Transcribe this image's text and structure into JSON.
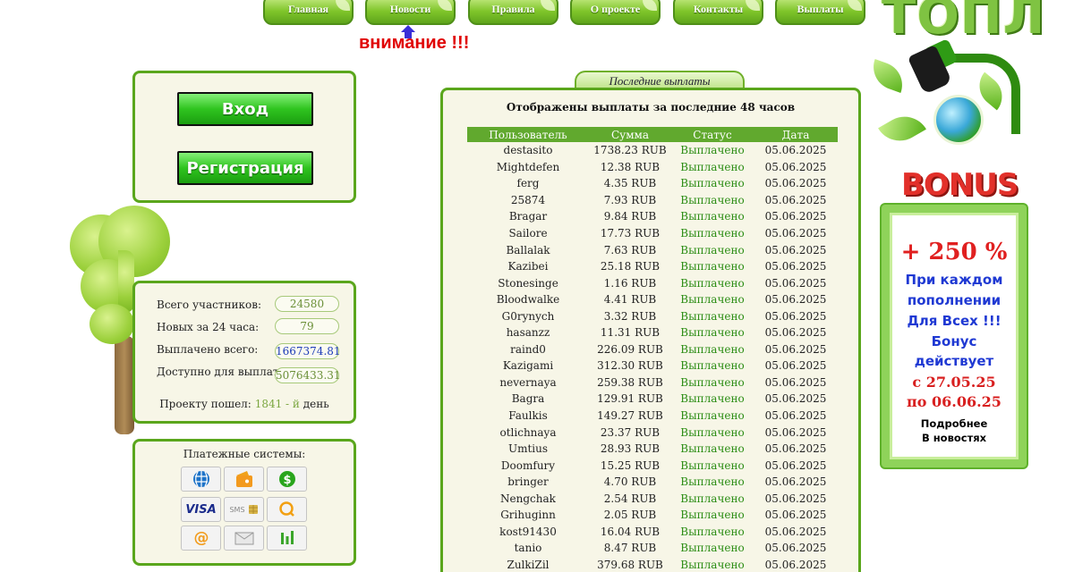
{
  "nav": {
    "items": [
      "Главная",
      "Новости",
      "Правила",
      "О проекте",
      "Контакты",
      "Выплаты"
    ]
  },
  "attention": "внимание !!!",
  "auth": {
    "login_label": "Вход",
    "register_label": "Регистрация"
  },
  "stats": {
    "total_participants_label": "Всего участников:",
    "total_participants": "24580",
    "new_24h_label": "Новых за 24 часа:",
    "new_24h": "79",
    "paid_total_label": "Выплачено всего:",
    "paid_total": "1667374.81",
    "available_label": "Доступно для выплат:",
    "available": "5076433.31",
    "age_prefix": "Проекту пошел:",
    "age_value": "1841 - й",
    "age_suffix": "день"
  },
  "payment_systems": {
    "title": "Платежные системы:",
    "items": [
      "webmoney-icon",
      "yandex-money-icon",
      "dollar-icon",
      "visa-icon",
      "sms-icon",
      "qiwi-icon",
      "at-icon",
      "envelope-icon",
      "bars-icon"
    ],
    "visa_text": "VISA",
    "sms_text": "SMS"
  },
  "payouts": {
    "tab_label": "Последние выплаты",
    "heading": "Отображены выплаты за последние 48 часов",
    "columns": [
      "Пользователь",
      "Сумма",
      "Статус",
      "Дата"
    ],
    "rows": [
      [
        "destasito",
        "1738.23 RUB",
        "Выплачено",
        "05.06.2025"
      ],
      [
        "Mightdefen",
        "12.38 RUB",
        "Выплачено",
        "05.06.2025"
      ],
      [
        "ferg",
        "4.35 RUB",
        "Выплачено",
        "05.06.2025"
      ],
      [
        "25874",
        "7.93 RUB",
        "Выплачено",
        "05.06.2025"
      ],
      [
        "Bragar",
        "9.84 RUB",
        "Выплачено",
        "05.06.2025"
      ],
      [
        "Sailore",
        "17.73 RUB",
        "Выплачено",
        "05.06.2025"
      ],
      [
        "Ballalak",
        "7.63 RUB",
        "Выплачено",
        "05.06.2025"
      ],
      [
        "Kazibei",
        "25.18 RUB",
        "Выплачено",
        "05.06.2025"
      ],
      [
        "Stonesinge",
        "1.16 RUB",
        "Выплачено",
        "05.06.2025"
      ],
      [
        "Bloodwalke",
        "4.41 RUB",
        "Выплачено",
        "05.06.2025"
      ],
      [
        "G0rynych",
        "3.32 RUB",
        "Выплачено",
        "05.06.2025"
      ],
      [
        "hasanzz",
        "11.31 RUB",
        "Выплачено",
        "05.06.2025"
      ],
      [
        "raind0",
        "226.09 RUB",
        "Выплачено",
        "05.06.2025"
      ],
      [
        "Kazigami",
        "312.30 RUB",
        "Выплачено",
        "05.06.2025"
      ],
      [
        "nevernaya",
        "259.38 RUB",
        "Выплачено",
        "05.06.2025"
      ],
      [
        "Bagra",
        "129.91 RUB",
        "Выплачено",
        "05.06.2025"
      ],
      [
        "Faulkis",
        "149.27 RUB",
        "Выплачено",
        "05.06.2025"
      ],
      [
        "otlichnaya",
        "23.37 RUB",
        "Выплачено",
        "05.06.2025"
      ],
      [
        "Umtius",
        "28.93 RUB",
        "Выплачено",
        "05.06.2025"
      ],
      [
        "Doomfury",
        "15.25 RUB",
        "Выплачено",
        "05.06.2025"
      ],
      [
        "bringer",
        "4.70 RUB",
        "Выплачено",
        "05.06.2025"
      ],
      [
        "Nengchak",
        "2.54 RUB",
        "Выплачено",
        "05.06.2025"
      ],
      [
        "Grihuginn",
        "2.05 RUB",
        "Выплачено",
        "05.06.2025"
      ],
      [
        "kost91430",
        "16.04 RUB",
        "Выплачено",
        "05.06.2025"
      ],
      [
        "tanio",
        "8.47 RUB",
        "Выплачено",
        "05.06.2025"
      ],
      [
        "ZulkiZil",
        "379.68 RUB",
        "Выплачено",
        "05.06.2025"
      ]
    ]
  },
  "branding": {
    "logo_text": "ТОПЛ",
    "bonus_text": "BONUS"
  },
  "promo": {
    "percent": "+ 250 %",
    "line1": "При каждом",
    "line2": "пополнении",
    "line3": "Для Всех !!!",
    "line4": "Бонус",
    "line5": "действует",
    "from": "с 27.05.25",
    "to": "по 06.06.25",
    "more1": "Подробнее",
    "more2": "В новостях"
  },
  "colors": {
    "accent_green": "#5aa61c",
    "status_green": "#2c8d15",
    "attention_red": "#e00000",
    "panel_bg": "#f7f6e7"
  }
}
